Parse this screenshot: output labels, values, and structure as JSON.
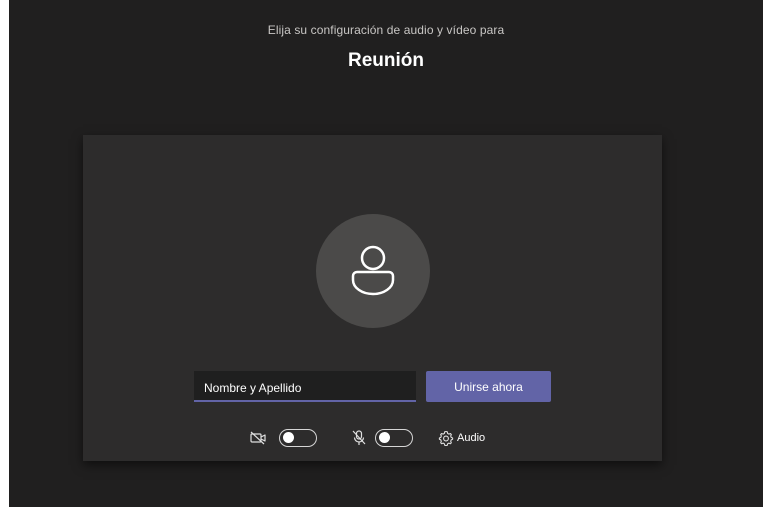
{
  "header": {
    "subtitle": "Elija su configuración de audio y vídeo para",
    "title": "Reunión"
  },
  "preview": {
    "avatar_icon": "person-icon"
  },
  "join": {
    "name_value": "Nombre y Apellido",
    "join_label": "Unirse ahora"
  },
  "controls": {
    "camera_icon": "camera-off-icon",
    "camera_on": false,
    "mic_icon": "mic-off-icon",
    "mic_on": false,
    "settings_icon": "gear-icon",
    "audio_label": "Audio"
  },
  "colors": {
    "background": "#201f1f",
    "card": "#2d2c2c",
    "accent": "#6264a7"
  }
}
